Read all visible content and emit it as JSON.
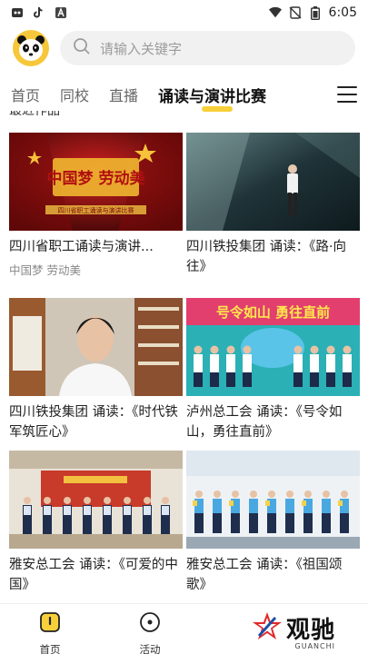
{
  "status_bar": {
    "time": "6:05",
    "icons": [
      "app-notification-icon",
      "tiktok-icon",
      "a-icon",
      "wifi-icon",
      "no-sim-icon",
      "battery-icon"
    ]
  },
  "header": {
    "logo": "panda-logo",
    "search": {
      "placeholder": "请输入关键字",
      "icon": "search-icon"
    }
  },
  "tabs": [
    {
      "label": "首页",
      "active": false
    },
    {
      "label": "同校",
      "active": false
    },
    {
      "label": "直播",
      "active": false
    },
    {
      "label": "诵读与演讲比赛",
      "active": true
    }
  ],
  "section_title_partial": "最近作品",
  "cards": [
    {
      "title": "四川省职工诵读与演讲...",
      "subtitle": "中国梦 劳动美",
      "thumb_text": "中国梦 劳动美",
      "thumb_caption": "四川省职工诵读与演讲比赛"
    },
    {
      "title": "四川铁投集团 诵读：《路·向往》",
      "subtitle": ""
    },
    {
      "title": "四川铁投集团 诵读：《时代铁军筑匠心》",
      "subtitle": ""
    },
    {
      "title": "泸州总工会 诵读：《号令如山，勇往直前》",
      "subtitle": "",
      "thumb_text": "号令如山  勇往直前"
    },
    {
      "title": "雅安总工会 诵读：《可爱的中国》",
      "subtitle": ""
    },
    {
      "title": "雅安总工会 诵读：《祖国颂歌》",
      "subtitle": ""
    }
  ],
  "bottom_nav": {
    "items": [
      {
        "label": "首页",
        "icon": "home-icon",
        "active": true
      },
      {
        "label": "活动",
        "icon": "activity-icon",
        "active": false
      }
    ],
    "brand": {
      "name": "观驰",
      "sub": "GUANCHI"
    }
  },
  "colors": {
    "accent": "#f7cf3a",
    "text": "#222222",
    "muted": "#888888"
  }
}
